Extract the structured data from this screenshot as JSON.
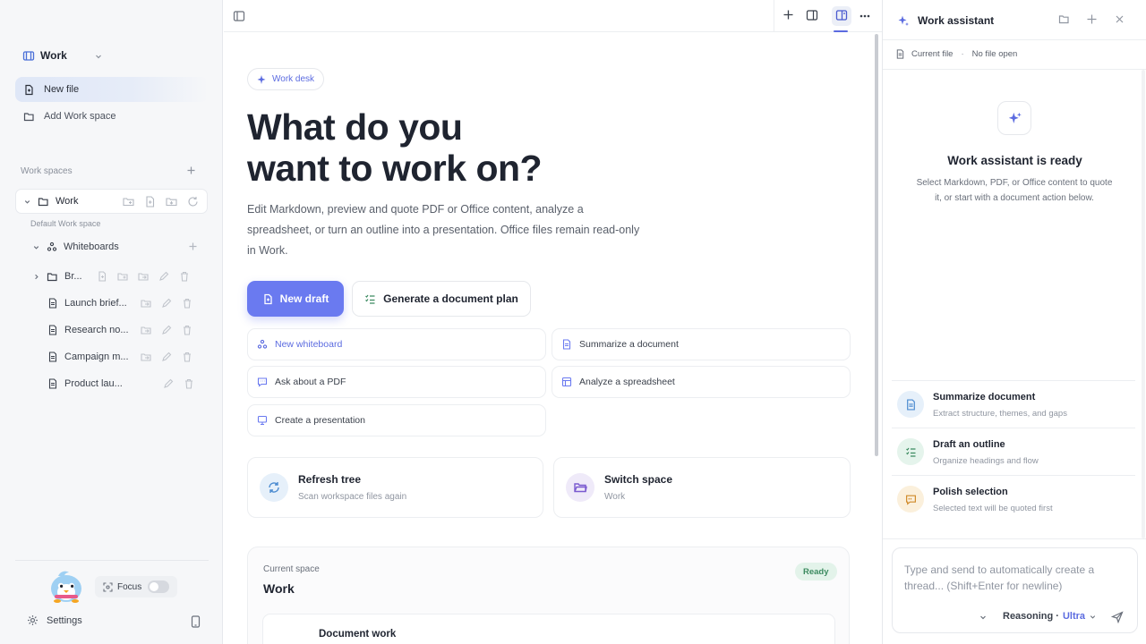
{
  "sidebar": {
    "workspace_switch": "Work",
    "new_file": "New file",
    "add_space": "Add Work space",
    "section_title": "Work spaces",
    "workspace": {
      "name": "Work",
      "subtitle": "Default Work space"
    },
    "tree": {
      "folder": "Whiteboards",
      "items": [
        {
          "label": "Br...",
          "type": "folder"
        },
        {
          "label": "Launch brief...",
          "type": "file"
        },
        {
          "label": "Research no...",
          "type": "file"
        },
        {
          "label": "Campaign m...",
          "type": "file"
        },
        {
          "label": "Product lau...",
          "type": "file"
        }
      ]
    },
    "focus_label": "Focus",
    "focus_on": false,
    "settings": "Settings"
  },
  "main": {
    "chip": "Work desk",
    "hero_line1": "What do you",
    "hero_line2": "want to work on?",
    "description": "Edit Markdown, preview and quote PDF or Office content, analyze a spreadsheet, or turn an outline into a presentation. Office files remain read-only in Work.",
    "primary_button": "New draft",
    "secondary_button": "Generate a document plan",
    "actions": [
      {
        "label": "New whiteboard",
        "icon": "whiteboard-icon"
      },
      {
        "label": "Summarize a document",
        "icon": "document-icon"
      },
      {
        "label": "Ask about a PDF",
        "icon": "chat-icon"
      },
      {
        "label": "Analyze a spreadsheet",
        "icon": "table-icon"
      },
      {
        "label": "Create a presentation",
        "icon": "presentation-icon"
      }
    ],
    "cards": [
      {
        "title": "Refresh tree",
        "subtitle": "Scan workspace files again"
      },
      {
        "title": "Switch space",
        "subtitle": "Work"
      }
    ],
    "space_card": {
      "caption": "Current space",
      "name": "Work",
      "badge": "Ready",
      "inner_title": "Document work"
    }
  },
  "assistant": {
    "title": "Work assistant",
    "current_file_label": "Current file",
    "current_file_value": "No file open",
    "ready_title": "Work assistant is ready",
    "ready_desc": "Select Markdown, PDF, or Office content to quote it, or start with a document action below.",
    "suggestions": [
      {
        "title": "Summarize document",
        "subtitle": "Extract structure, themes, and gaps"
      },
      {
        "title": "Draft an outline",
        "subtitle": "Organize headings and flow"
      },
      {
        "title": "Polish selection",
        "subtitle": "Selected text will be quoted first"
      }
    ],
    "composer_placeholder": "Type and send to automatically create a thread... (Shift+Enter for newline)",
    "reasoning_label": "Reasoning ·",
    "reasoning_level": "Ultra"
  },
  "colors": {
    "accent": "#6a7af0",
    "accent_text": "#5b6be0",
    "ready_badge": "#3b8a5f"
  }
}
